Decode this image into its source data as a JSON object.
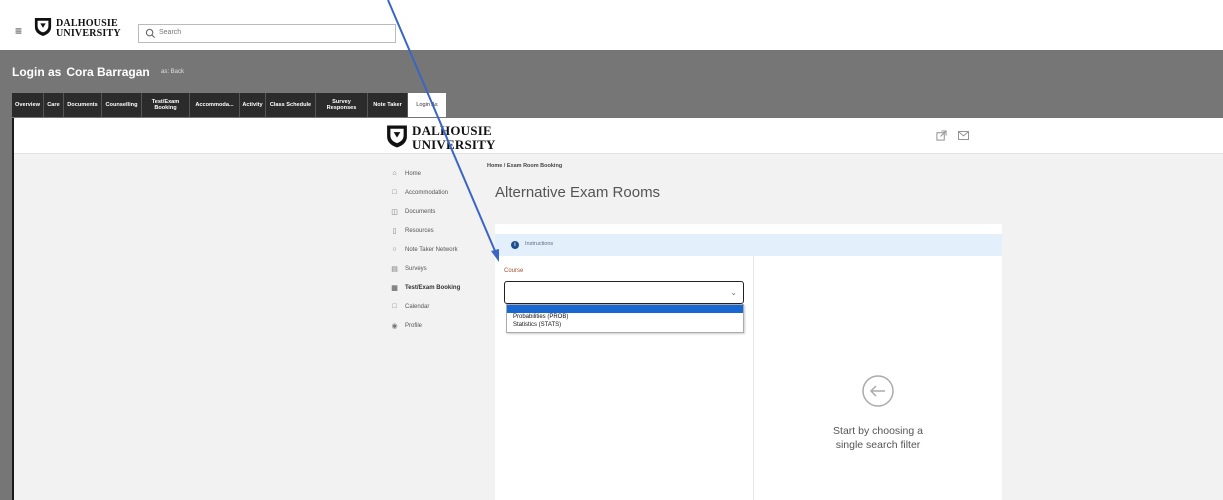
{
  "topbar": {
    "menu_icon": "hamburger-icon",
    "logo_line1": "DALHOUSIE",
    "logo_line2": "UNIVERSITY",
    "search_placeholder": "Search",
    "search_icon": "search-icon"
  },
  "admin": {
    "title_prefix": "Login as",
    "student_name": "Cora Barragan",
    "subtitle": "as: Back",
    "tabs": [
      {
        "label": "Overview"
      },
      {
        "label": "Care"
      },
      {
        "label": "Documents"
      },
      {
        "label": "Counselling"
      },
      {
        "label": "Test/Exam Booking"
      },
      {
        "label": "Accommoda..."
      },
      {
        "label": "Activity"
      },
      {
        "label": "Class Schedule"
      },
      {
        "label": "Survey Responses"
      },
      {
        "label": "Note Taker"
      },
      {
        "label": "Login As"
      }
    ]
  },
  "portal": {
    "logo_line1": "DALHOUSIE",
    "logo_line2": "UNIVERSITY",
    "header_icons": [
      "external-link-icon",
      "mail-icon"
    ],
    "nav": [
      {
        "label": "Home",
        "icon": "home-icon"
      },
      {
        "label": "Accommodation",
        "icon": "calendar-icon"
      },
      {
        "label": "Documents",
        "icon": "document-icon"
      },
      {
        "label": "Resources",
        "icon": "book-icon"
      },
      {
        "label": "Note Taker Network",
        "icon": "network-icon"
      },
      {
        "label": "Surveys",
        "icon": "survey-icon"
      },
      {
        "label": "Test/Exam Booking",
        "icon": "booking-icon"
      },
      {
        "label": "Calendar",
        "icon": "calendar-icon"
      },
      {
        "label": "Profile",
        "icon": "profile-icon"
      }
    ],
    "breadcrumb": "Home / Exam Room Booking",
    "page_title": "Alternative Exam Rooms",
    "instructions_label": "Instructions",
    "course_label": "Course",
    "course_value": "",
    "course_options": [
      {
        "label": "Probabilities (PROB)"
      },
      {
        "label": "Statistics (STATS)"
      }
    ],
    "empty_state": {
      "line1": "Start by choosing a",
      "line2": "single search filter",
      "icon": "arrow-left-circle-icon"
    }
  },
  "colors": {
    "admin_bar": "#767676",
    "tab_dark": "#2b2b2b",
    "instructions_bg": "#e3f0fb",
    "course_label": "#a0522d",
    "dropdown_highlight": "#1967d2",
    "annotation_arrow": "#3a66c4"
  }
}
